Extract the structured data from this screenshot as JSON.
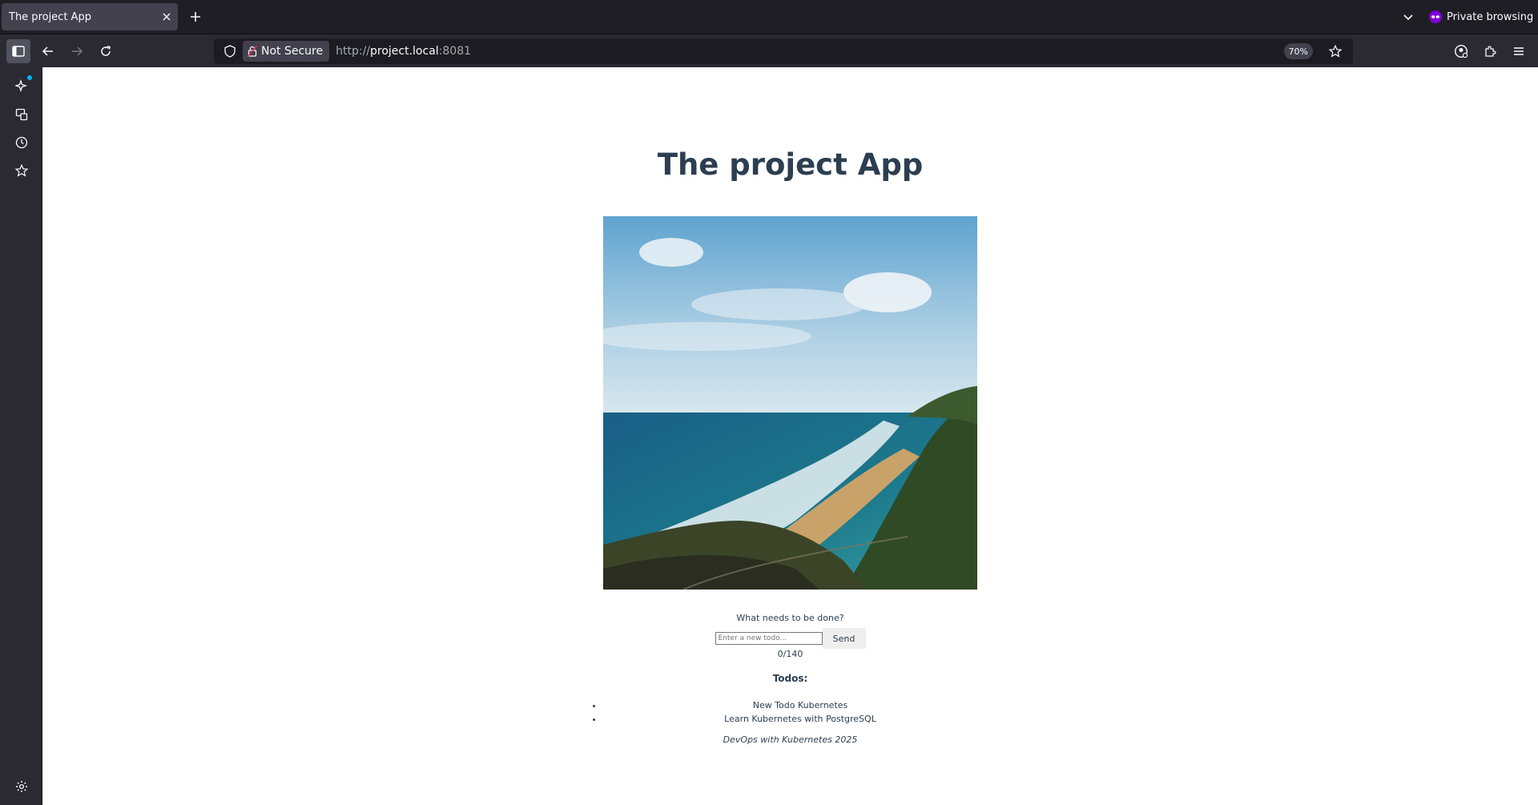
{
  "browser": {
    "tab_title": "The project App",
    "private_label": "Private browsing",
    "security_label": "Not Secure",
    "url": {
      "scheme": "http://",
      "host": "project.local",
      "port": ":8081"
    },
    "zoom": "70%"
  },
  "app": {
    "title": "The project App",
    "prompt": "What needs to be done?",
    "input_placeholder": "Enter a new todo...",
    "input_value": "",
    "send_label": "Send",
    "counter": "0/140",
    "todos_heading": "Todos:",
    "todos": [
      "New Todo Kubernetes",
      "Learn Kubernetes with PostgreSQL"
    ],
    "footer": "DevOps with Kubernetes 2025"
  },
  "colors": {
    "heading": "#2c3e50",
    "private_accent": "#8000d7",
    "sidebar_badge": "#00b3f4"
  }
}
